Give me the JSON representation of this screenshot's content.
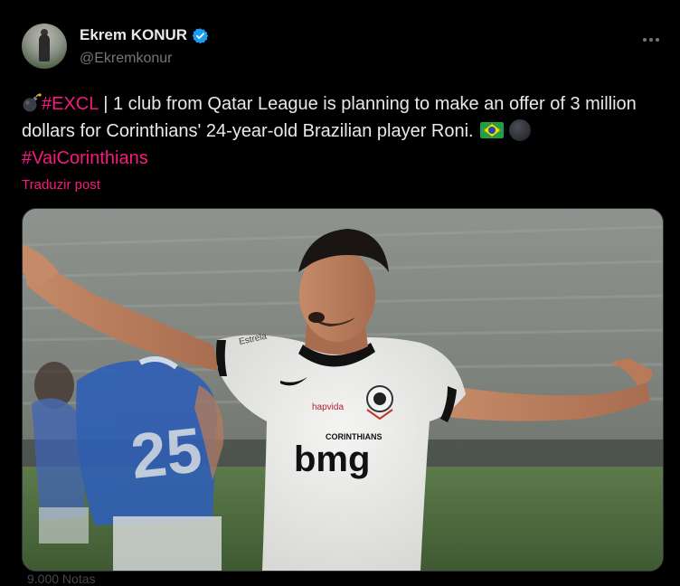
{
  "author": {
    "display_name": "Ekrem KONUR",
    "handle": "@Ekremkonur",
    "verified": true
  },
  "tweet": {
    "hashtag_1": "#EXCL",
    "body": " | 1 club from Qatar League is planning to make an offer of 3 million dollars for Corinthians' 24-year-old Brazilian player Roni. ",
    "hashtag_2": "#VaiCorinthians",
    "emojis": [
      "bomb-icon",
      "brazil-flag-icon",
      "football-icon"
    ]
  },
  "translate_label": "Traduzir post",
  "media": {
    "shirt_sponsor": "bmg",
    "shirt_sponsor_small": "CORINTHIANS",
    "shirt_sleeve": "hapvida",
    "shirt_brand": "Estrela",
    "opponent_number": "25"
  },
  "footer_hint": "9.000 Notas",
  "colors": {
    "accent": "#f91880",
    "verified": "#1d9bf0",
    "muted": "#71767b",
    "text": "#e7e9ea",
    "background": "#000000"
  }
}
